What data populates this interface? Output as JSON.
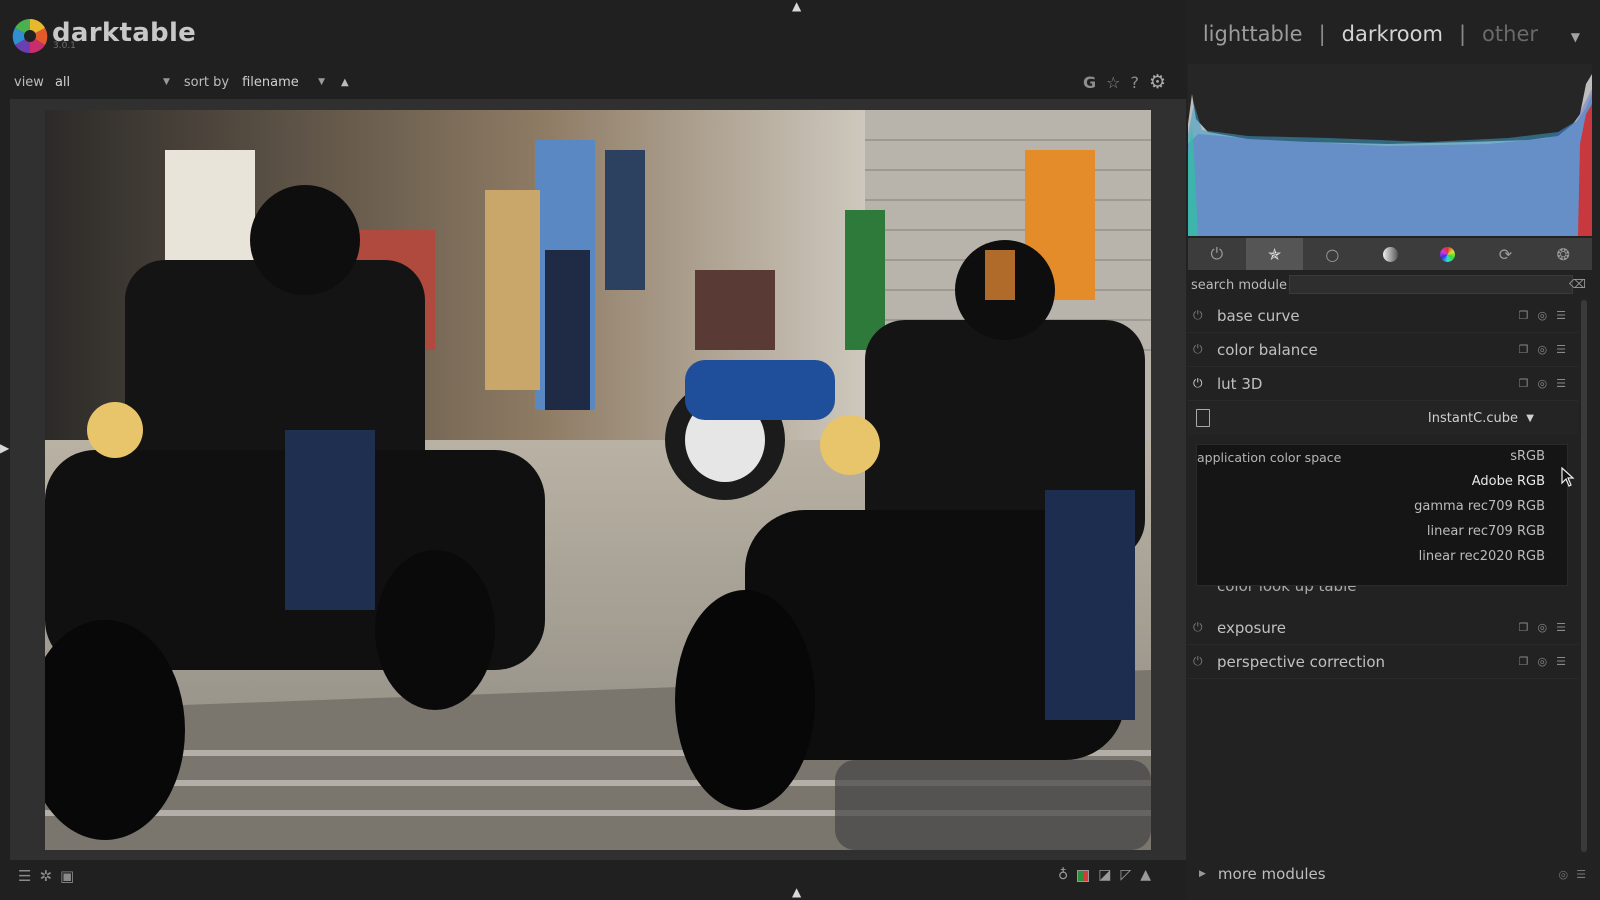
{
  "app": {
    "name": "darktable",
    "version": "3.0.1"
  },
  "views": {
    "lighttable": "lighttable",
    "darkroom": "darkroom",
    "other": "other",
    "separator": "|"
  },
  "filterbar": {
    "view_label": "view",
    "view_value": "all",
    "sort_label": "sort by",
    "sort_value": "filename",
    "sort_direction_icon": "sort-ascending-icon"
  },
  "top_icons": [
    "grouping-icon",
    "overlay-star-icon",
    "help-icon",
    "preferences-gear-icon"
  ],
  "module_groups": {
    "active": "favorites",
    "items": [
      "active-modules-icon",
      "favorites-icon",
      "base-group-icon",
      "tone-group-icon",
      "color-group-icon",
      "correct-group-icon",
      "effects-group-icon"
    ]
  },
  "search": {
    "label": "search module",
    "value": "",
    "placeholder": ""
  },
  "modules": [
    {
      "name": "base curve",
      "enabled": false
    },
    {
      "name": "color balance",
      "enabled": false
    },
    {
      "name": "lut 3D",
      "enabled": true,
      "expanded": true
    },
    {
      "name": "color look up table",
      "enabled": false
    },
    {
      "name": "exposure",
      "enabled": false
    },
    {
      "name": "perspective correction",
      "enabled": false
    }
  ],
  "lut3d": {
    "file": "InstantC.cube",
    "application_color_space_label": "application color space",
    "color_space_options": [
      "sRGB",
      "Adobe RGB",
      "gamma rec709 RGB",
      "linear rec709 RGB",
      "linear rec2020 RGB"
    ],
    "hovered_option": "Adobe RGB"
  },
  "more_modules": "more modules",
  "bottom_left_icons": [
    "presets-icon",
    "styles-icon",
    "second-window-icon"
  ],
  "bottom_right_icons": [
    "iso12646-bulb-icon",
    "softproof-icon",
    "gamut-check-icon",
    "guides-icon",
    "overexposed-warning-icon"
  ],
  "colors": {
    "background": "#202020",
    "panel": "#222222",
    "active_group": "#555555",
    "popup": "#151515"
  }
}
